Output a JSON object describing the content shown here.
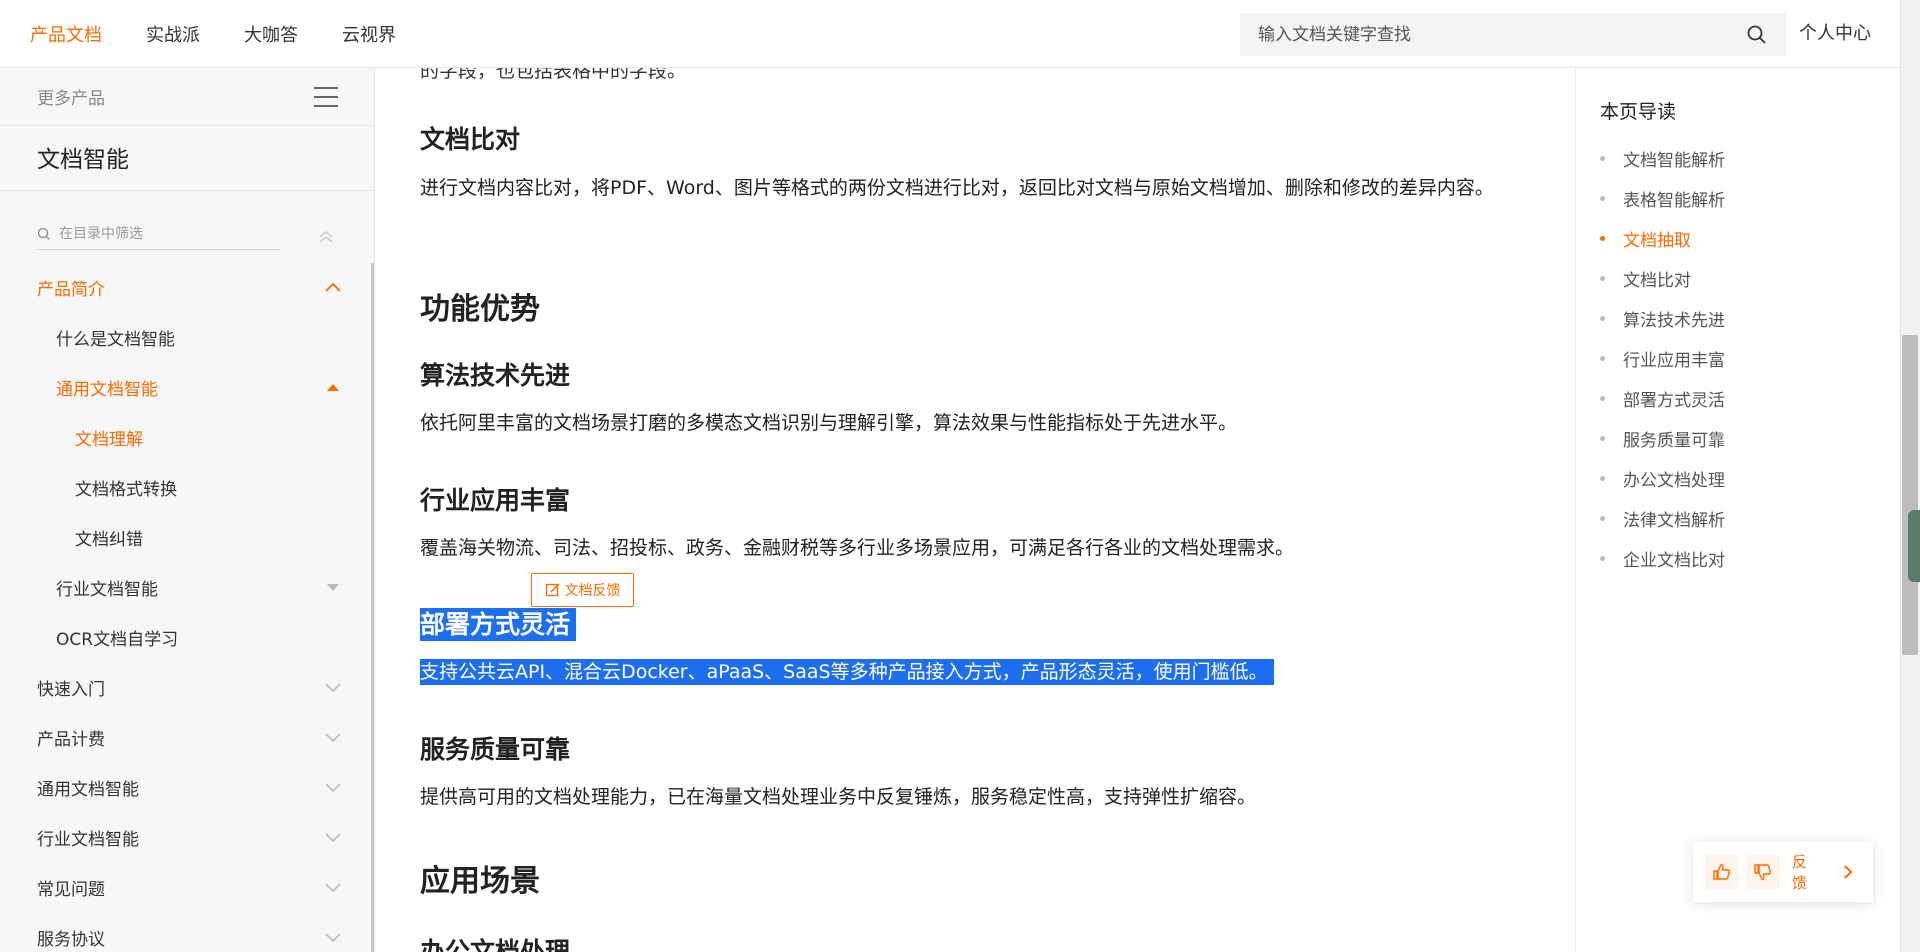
{
  "topnav": {
    "items": [
      "产品文档",
      "实战派",
      "大咖答",
      "云视界"
    ],
    "active_index": 0,
    "search_placeholder": "输入文档关键字查找",
    "personal_center": "个人中心"
  },
  "sidebar": {
    "more_products": "更多产品",
    "product_title": "文档智能",
    "filter_placeholder": "在目录中筛选",
    "items": [
      {
        "label": "产品简介",
        "active": true,
        "chevron": "chevron-up"
      },
      {
        "label": "什么是文档智能",
        "active": false,
        "chevron": ""
      },
      {
        "label": "通用文档智能",
        "active": true,
        "chevron": "caret-up"
      },
      {
        "label": "文档理解",
        "active": true,
        "chevron": ""
      },
      {
        "label": "文档格式转换",
        "active": false,
        "chevron": ""
      },
      {
        "label": "文档纠错",
        "active": false,
        "chevron": ""
      },
      {
        "label": "行业文档智能",
        "active": false,
        "chevron": "caret-down"
      },
      {
        "label": "OCR文档自学习",
        "active": false,
        "chevron": ""
      },
      {
        "label": "快速入门",
        "active": false,
        "chevron": "chevron-down"
      },
      {
        "label": "产品计费",
        "active": false,
        "chevron": "chevron-down"
      },
      {
        "label": "通用文档智能",
        "active": false,
        "chevron": "chevron-down"
      },
      {
        "label": "行业文档智能",
        "active": false,
        "chevron": "chevron-down"
      },
      {
        "label": "常见问题",
        "active": false,
        "chevron": "chevron-down"
      },
      {
        "label": "服务协议",
        "active": false,
        "chevron": "chevron-down"
      }
    ]
  },
  "content": {
    "cut_text": "的字段，也包括表格中的字段。",
    "doc_compare_title": "文档比对",
    "doc_compare_text": "进行文档内容比对，将PDF、Word、图片等格式的两份文档进行比对，返回比对文档与原始文档增加、删除和修改的差异内容。",
    "advantages_title": "功能优势",
    "algo_title": "算法技术先进",
    "algo_text": "依托阿里丰富的文档场景打磨的多模态文档识别与理解引擎，算法效果与性能指标处于先进水平。",
    "industry_title": "行业应用丰富",
    "industry_text": "覆盖海关物流、司法、招投标、政务、金融财税等多行业多场景应用，可满足各行各业的文档处理需求。",
    "deploy_title": "部署方式灵活",
    "deploy_text": "支持公共云API、混合云Docker、aPaaS、SaaS等多种产品接入方式，产品形态灵活，使用门槛低。",
    "quality_title": "服务质量可靠",
    "quality_text": "提供高可用的文档处理能力，已在海量文档处理业务中反复锤炼，服务稳定性高，支持弹性扩缩容。",
    "scenarios_title": "应用场景",
    "office_title": "办公文档处理",
    "doc_feedback": "文档反馈"
  },
  "toc": {
    "title": "本页导读",
    "items": [
      "文档智能解析",
      "表格智能解析",
      "文档抽取",
      "文档比对",
      "算法技术先进",
      "行业应用丰富",
      "部署方式灵活",
      "服务质量可靠",
      "办公文档处理",
      "法律文档解析",
      "企业文档比对"
    ],
    "active_index": 2
  },
  "feedback_bar": {
    "label": "反馈"
  },
  "colors": {
    "accent": "#ff6a00",
    "selection": "#1e6ef0"
  }
}
